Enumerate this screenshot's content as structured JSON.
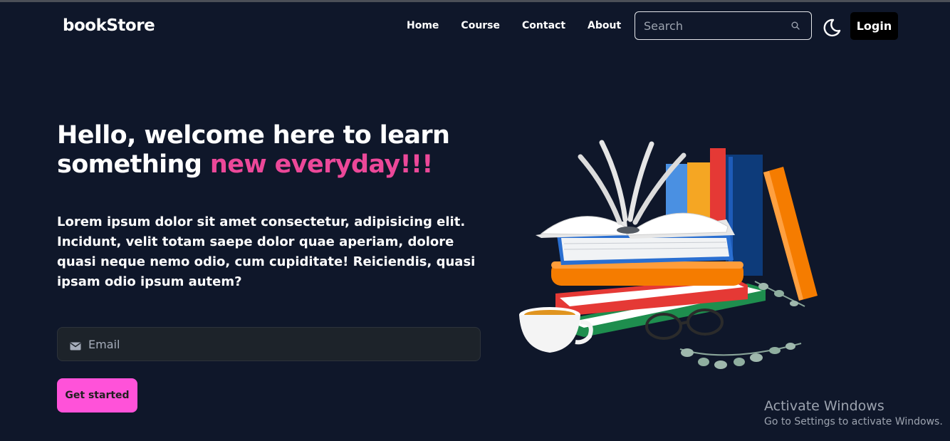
{
  "navbar": {
    "logo": "bookStore",
    "links": [
      "Home",
      "Course",
      "Contact",
      "About"
    ],
    "search_placeholder": "Search",
    "login_label": "Login"
  },
  "hero": {
    "title_part1": "Hello, welcome here to learn something ",
    "title_accent": "new everyday!!!",
    "description": "Lorem ipsum dolor sit amet consectetur, adipisicing elit. Incidunt, velit totam saepe dolor quae aperiam, dolore quasi neque nemo odio, cum cupiditate! Reiciendis, quasi ipsam odio ipsum autem?",
    "email_placeholder": "Email",
    "cta_label": "Get started"
  },
  "watermark": {
    "title": "Activate Windows",
    "subtitle": "Go to Settings to activate Windows."
  },
  "colors": {
    "background": "#0f172a",
    "accent_pink": "#ec4899",
    "button_pink": "#ff52d9"
  },
  "icons": {
    "search": "search-icon",
    "theme_toggle": "moon-icon",
    "email": "mail-icon"
  }
}
